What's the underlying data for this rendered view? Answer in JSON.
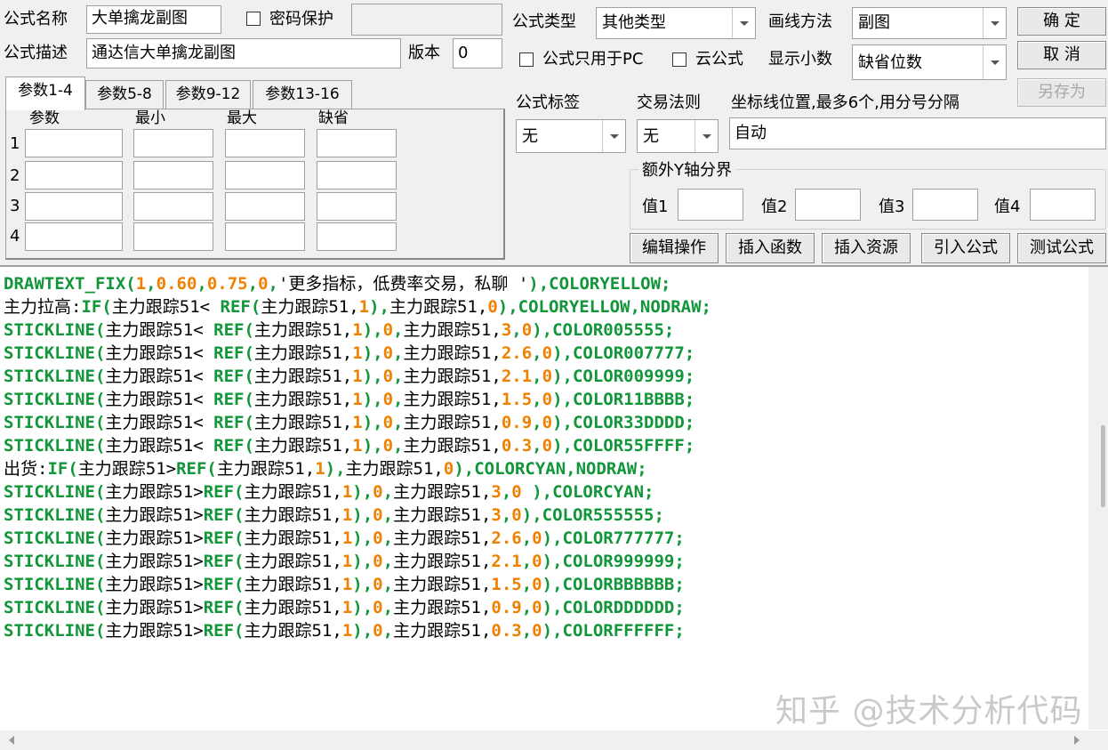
{
  "form": {
    "name_label": "公式名称",
    "name_value": "大单擒龙副图",
    "password_label": "密码保护",
    "password_value": "",
    "desc_label": "公式描述",
    "desc_value": "通达信大单擒龙副图",
    "version_label": "版本",
    "version_value": "0",
    "type_label": "公式类型",
    "type_value": "其他类型",
    "draw_label": "画线方法",
    "draw_value": "副图",
    "pc_only_label": "公式只用于PC",
    "cloud_label": "云公式",
    "decimals_label": "显示小数",
    "decimals_value": "缺省位数",
    "tag_label": "公式标签",
    "tag_value": "无",
    "rule_label": "交易法则",
    "rule_value": "无",
    "coord_label": "坐标线位置,最多6个,用分号分隔",
    "coord_value": "自动",
    "yaxis_group": "额外Y轴分界",
    "val1": "值1",
    "val2": "值2",
    "val3": "值3",
    "val4": "值4"
  },
  "buttons": {
    "ok": "确 定",
    "cancel": "取 消",
    "save_as": "另存为",
    "edit": "编辑操作",
    "insert_func": "插入函数",
    "insert_res": "插入资源",
    "import": "引入公式",
    "test": "测试公式"
  },
  "tabs": [
    "参数1-4",
    "参数5-8",
    "参数9-12",
    "参数13-16"
  ],
  "params": {
    "headers": [
      "参数",
      "最小",
      "最大",
      "缺省"
    ],
    "rows": [
      "1",
      "2",
      "3",
      "4"
    ]
  },
  "code_lines": [
    [
      [
        "ascii",
        "DRAWTEXT_FIX("
      ],
      [
        "num",
        "1"
      ],
      [
        "ascii",
        ","
      ],
      [
        "num",
        "0.60"
      ],
      [
        "ascii",
        ","
      ],
      [
        "num",
        "0.75"
      ],
      [
        "ascii",
        ","
      ],
      [
        "num",
        "0"
      ],
      [
        "ascii",
        ","
      ],
      [
        "txt",
        "'更多指标，低费率交易，私聊 '"
      ],
      [
        "ascii",
        "),COLORYELLOW;"
      ]
    ],
    [
      [
        "txt",
        "主力拉高:"
      ],
      [
        "ascii",
        "IF("
      ],
      [
        "txt",
        "主力跟踪51< "
      ],
      [
        "ascii",
        "REF("
      ],
      [
        "txt",
        "主力跟踪51,"
      ],
      [
        "num",
        "1"
      ],
      [
        "ascii",
        "),"
      ],
      [
        "txt",
        "主力跟踪51,"
      ],
      [
        "num",
        "0"
      ],
      [
        "ascii",
        "),COLORYELLOW,NODRAW;"
      ]
    ],
    [
      [
        "ascii",
        "STICKLINE("
      ],
      [
        "txt",
        "主力跟踪51< "
      ],
      [
        "ascii",
        "REF("
      ],
      [
        "txt",
        "主力跟踪51,"
      ],
      [
        "num",
        "1"
      ],
      [
        "ascii",
        "),"
      ],
      [
        "num",
        "0"
      ],
      [
        "ascii",
        ","
      ],
      [
        "txt",
        "主力跟踪51,"
      ],
      [
        "num",
        "3"
      ],
      [
        "ascii",
        ","
      ],
      [
        "num",
        "0"
      ],
      [
        "ascii",
        "),COLOR005555;"
      ]
    ],
    [
      [
        "ascii",
        "STICKLINE("
      ],
      [
        "txt",
        "主力跟踪51< "
      ],
      [
        "ascii",
        "REF("
      ],
      [
        "txt",
        "主力跟踪51,"
      ],
      [
        "num",
        "1"
      ],
      [
        "ascii",
        "),"
      ],
      [
        "num",
        "0"
      ],
      [
        "ascii",
        ","
      ],
      [
        "txt",
        "主力跟踪51,"
      ],
      [
        "num",
        "2.6"
      ],
      [
        "ascii",
        ","
      ],
      [
        "num",
        "0"
      ],
      [
        "ascii",
        "),COLOR007777;"
      ]
    ],
    [
      [
        "ascii",
        "STICKLINE("
      ],
      [
        "txt",
        "主力跟踪51< "
      ],
      [
        "ascii",
        "REF("
      ],
      [
        "txt",
        "主力跟踪51,"
      ],
      [
        "num",
        "1"
      ],
      [
        "ascii",
        "),"
      ],
      [
        "num",
        "0"
      ],
      [
        "ascii",
        ","
      ],
      [
        "txt",
        "主力跟踪51,"
      ],
      [
        "num",
        "2.1"
      ],
      [
        "ascii",
        ","
      ],
      [
        "num",
        "0"
      ],
      [
        "ascii",
        "),COLOR009999;"
      ]
    ],
    [
      [
        "ascii",
        "STICKLINE("
      ],
      [
        "txt",
        "主力跟踪51< "
      ],
      [
        "ascii",
        "REF("
      ],
      [
        "txt",
        "主力跟踪51,"
      ],
      [
        "num",
        "1"
      ],
      [
        "ascii",
        "),"
      ],
      [
        "num",
        "0"
      ],
      [
        "ascii",
        ","
      ],
      [
        "txt",
        "主力跟踪51,"
      ],
      [
        "num",
        "1.5"
      ],
      [
        "ascii",
        ","
      ],
      [
        "num",
        "0"
      ],
      [
        "ascii",
        "),COLOR11BBBB;"
      ]
    ],
    [
      [
        "ascii",
        "STICKLINE("
      ],
      [
        "txt",
        "主力跟踪51< "
      ],
      [
        "ascii",
        "REF("
      ],
      [
        "txt",
        "主力跟踪51,"
      ],
      [
        "num",
        "1"
      ],
      [
        "ascii",
        "),"
      ],
      [
        "num",
        "0"
      ],
      [
        "ascii",
        ","
      ],
      [
        "txt",
        "主力跟踪51,"
      ],
      [
        "num",
        "0.9"
      ],
      [
        "ascii",
        ","
      ],
      [
        "num",
        "0"
      ],
      [
        "ascii",
        "),COLOR33DDDD;"
      ]
    ],
    [
      [
        "ascii",
        "STICKLINE("
      ],
      [
        "txt",
        "主力跟踪51< "
      ],
      [
        "ascii",
        "REF("
      ],
      [
        "txt",
        "主力跟踪51,"
      ],
      [
        "num",
        "1"
      ],
      [
        "ascii",
        "),"
      ],
      [
        "num",
        "0"
      ],
      [
        "ascii",
        ","
      ],
      [
        "txt",
        "主力跟踪51,"
      ],
      [
        "num",
        "0.3"
      ],
      [
        "ascii",
        ","
      ],
      [
        "num",
        "0"
      ],
      [
        "ascii",
        "),COLOR55FFFF;"
      ]
    ],
    [
      [
        "txt",
        "出货:"
      ],
      [
        "ascii",
        "IF("
      ],
      [
        "txt",
        "主力跟踪51>"
      ],
      [
        "ascii",
        "REF("
      ],
      [
        "txt",
        "主力跟踪51,"
      ],
      [
        "num",
        "1"
      ],
      [
        "ascii",
        "),"
      ],
      [
        "txt",
        "主力跟踪51,"
      ],
      [
        "num",
        "0"
      ],
      [
        "ascii",
        "),COLORCYAN,NODRAW;"
      ]
    ],
    [
      [
        "ascii",
        "STICKLINE("
      ],
      [
        "txt",
        "主力跟踪51>"
      ],
      [
        "ascii",
        "REF("
      ],
      [
        "txt",
        "主力跟踪51,"
      ],
      [
        "num",
        "1"
      ],
      [
        "ascii",
        "),"
      ],
      [
        "num",
        "0"
      ],
      [
        "ascii",
        ","
      ],
      [
        "txt",
        "主力跟踪51,"
      ],
      [
        "num",
        "3"
      ],
      [
        "ascii",
        ","
      ],
      [
        "num",
        "0"
      ],
      [
        "ascii",
        " ),COLORCYAN;"
      ]
    ],
    [
      [
        "ascii",
        "STICKLINE("
      ],
      [
        "txt",
        "主力跟踪51>"
      ],
      [
        "ascii",
        "REF("
      ],
      [
        "txt",
        "主力跟踪51,"
      ],
      [
        "num",
        "1"
      ],
      [
        "ascii",
        "),"
      ],
      [
        "num",
        "0"
      ],
      [
        "ascii",
        ","
      ],
      [
        "txt",
        "主力跟踪51,"
      ],
      [
        "num",
        "3"
      ],
      [
        "ascii",
        ","
      ],
      [
        "num",
        "0"
      ],
      [
        "ascii",
        "),COLOR555555;"
      ]
    ],
    [
      [
        "ascii",
        "STICKLINE("
      ],
      [
        "txt",
        "主力跟踪51>"
      ],
      [
        "ascii",
        "REF("
      ],
      [
        "txt",
        "主力跟踪51,"
      ],
      [
        "num",
        "1"
      ],
      [
        "ascii",
        "),"
      ],
      [
        "num",
        "0"
      ],
      [
        "ascii",
        ","
      ],
      [
        "txt",
        "主力跟踪51,"
      ],
      [
        "num",
        "2.6"
      ],
      [
        "ascii",
        ","
      ],
      [
        "num",
        "0"
      ],
      [
        "ascii",
        "),COLOR777777;"
      ]
    ],
    [
      [
        "ascii",
        "STICKLINE("
      ],
      [
        "txt",
        "主力跟踪51>"
      ],
      [
        "ascii",
        "REF("
      ],
      [
        "txt",
        "主力跟踪51,"
      ],
      [
        "num",
        "1"
      ],
      [
        "ascii",
        "),"
      ],
      [
        "num",
        "0"
      ],
      [
        "ascii",
        ","
      ],
      [
        "txt",
        "主力跟踪51,"
      ],
      [
        "num",
        "2.1"
      ],
      [
        "ascii",
        ","
      ],
      [
        "num",
        "0"
      ],
      [
        "ascii",
        "),COLOR999999;"
      ]
    ],
    [
      [
        "ascii",
        "STICKLINE("
      ],
      [
        "txt",
        "主力跟踪51>"
      ],
      [
        "ascii",
        "REF("
      ],
      [
        "txt",
        "主力跟踪51,"
      ],
      [
        "num",
        "1"
      ],
      [
        "ascii",
        "),"
      ],
      [
        "num",
        "0"
      ],
      [
        "ascii",
        ","
      ],
      [
        "txt",
        "主力跟踪51,"
      ],
      [
        "num",
        "1.5"
      ],
      [
        "ascii",
        ","
      ],
      [
        "num",
        "0"
      ],
      [
        "ascii",
        "),COLORBBBBBB;"
      ]
    ],
    [
      [
        "ascii",
        "STICKLINE("
      ],
      [
        "txt",
        "主力跟踪51>"
      ],
      [
        "ascii",
        "REF("
      ],
      [
        "txt",
        "主力跟踪51,"
      ],
      [
        "num",
        "1"
      ],
      [
        "ascii",
        "),"
      ],
      [
        "num",
        "0"
      ],
      [
        "ascii",
        ","
      ],
      [
        "txt",
        "主力跟踪51,"
      ],
      [
        "num",
        "0.9"
      ],
      [
        "ascii",
        ","
      ],
      [
        "num",
        "0"
      ],
      [
        "ascii",
        "),COLORDDDDDD;"
      ]
    ],
    [
      [
        "ascii",
        "STICKLINE("
      ],
      [
        "txt",
        "主力跟踪51>"
      ],
      [
        "ascii",
        "REF("
      ],
      [
        "txt",
        "主力跟踪51,"
      ],
      [
        "num",
        "1"
      ],
      [
        "ascii",
        "),"
      ],
      [
        "num",
        "0"
      ],
      [
        "ascii",
        ","
      ],
      [
        "txt",
        "主力跟踪51,"
      ],
      [
        "num",
        "0.3"
      ],
      [
        "ascii",
        ","
      ],
      [
        "num",
        "0"
      ],
      [
        "ascii",
        "),COLORFFFFFF;"
      ]
    ]
  ],
  "colors": {
    "keyword": "#11963a",
    "number": "#f08000",
    "text": "#000000"
  },
  "watermark": "知乎 @技术分析代码"
}
